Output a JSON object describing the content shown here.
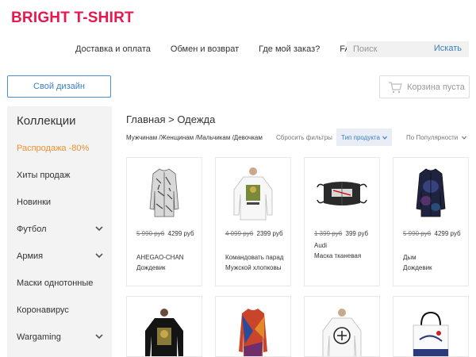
{
  "brand": {
    "logo": "BRIGHT T-SHIRT",
    "color": "#e8174c"
  },
  "nav": [
    "Доставка и оплата",
    "Обмен и возврат",
    "Где мой заказ?",
    "FAQ"
  ],
  "search": {
    "placeholder": "Поиск",
    "button": "Искать"
  },
  "design_button": "Свой дизайн",
  "cart_button": "Корзина пуста",
  "sidebar": {
    "title": "Коллекции",
    "items": [
      {
        "label": "Распродажа -80%",
        "expandable": false
      },
      {
        "label": "Хиты продаж",
        "expandable": false
      },
      {
        "label": "Новинки",
        "expandable": false
      },
      {
        "label": "Футбол",
        "expandable": true
      },
      {
        "label": "Армия",
        "expandable": true
      },
      {
        "label": "Маски однотонные",
        "expandable": false
      },
      {
        "label": "Коронавирус",
        "expandable": false
      },
      {
        "label": "Wargaming",
        "expandable": true
      }
    ]
  },
  "breadcrumb": {
    "home": "Главная",
    "sep": ">",
    "current": "Одежда"
  },
  "filters": {
    "categories": "Мужчинам /Женщинам /Мальчикам /Девочкам",
    "reset": "Сбросить фильтры",
    "type": "Тип продукта",
    "sort": "По Популярности"
  },
  "products": [
    {
      "old_price": "5 990 руб",
      "price": "4299",
      "currency": "руб",
      "name": "AHEGAO-CHAN",
      "type": "Дождевик",
      "icon": "coat-print-icon"
    },
    {
      "old_price": "4 099 руб",
      "price": "2399",
      "currency": "руб",
      "name": "Командовать парад",
      "type": "Мужской хлопковы",
      "icon": "sweatshirt-print-icon"
    },
    {
      "old_price": "1 399 руб",
      "price": "399 руб",
      "currency": "",
      "name": "Audi",
      "type": "Маска тканевая",
      "icon": "face-mask-icon"
    },
    {
      "old_price": "5 990 руб",
      "price": "4299",
      "currency": "руб",
      "name": "Дым",
      "type": "Дождевик",
      "icon": "coat-dark-icon"
    }
  ],
  "products_row2": [
    {
      "icon": "black-hoodie-icon"
    },
    {
      "icon": "colorful-coat-icon"
    },
    {
      "icon": "white-sweatshirt-icon"
    },
    {
      "icon": "tote-bag-icon"
    }
  ],
  "colors": {
    "accent": "#3d7fc3",
    "sale": "#f0912f",
    "sidebar_bg": "#f3f3f3",
    "filter_active_bg": "#e8edf6"
  }
}
